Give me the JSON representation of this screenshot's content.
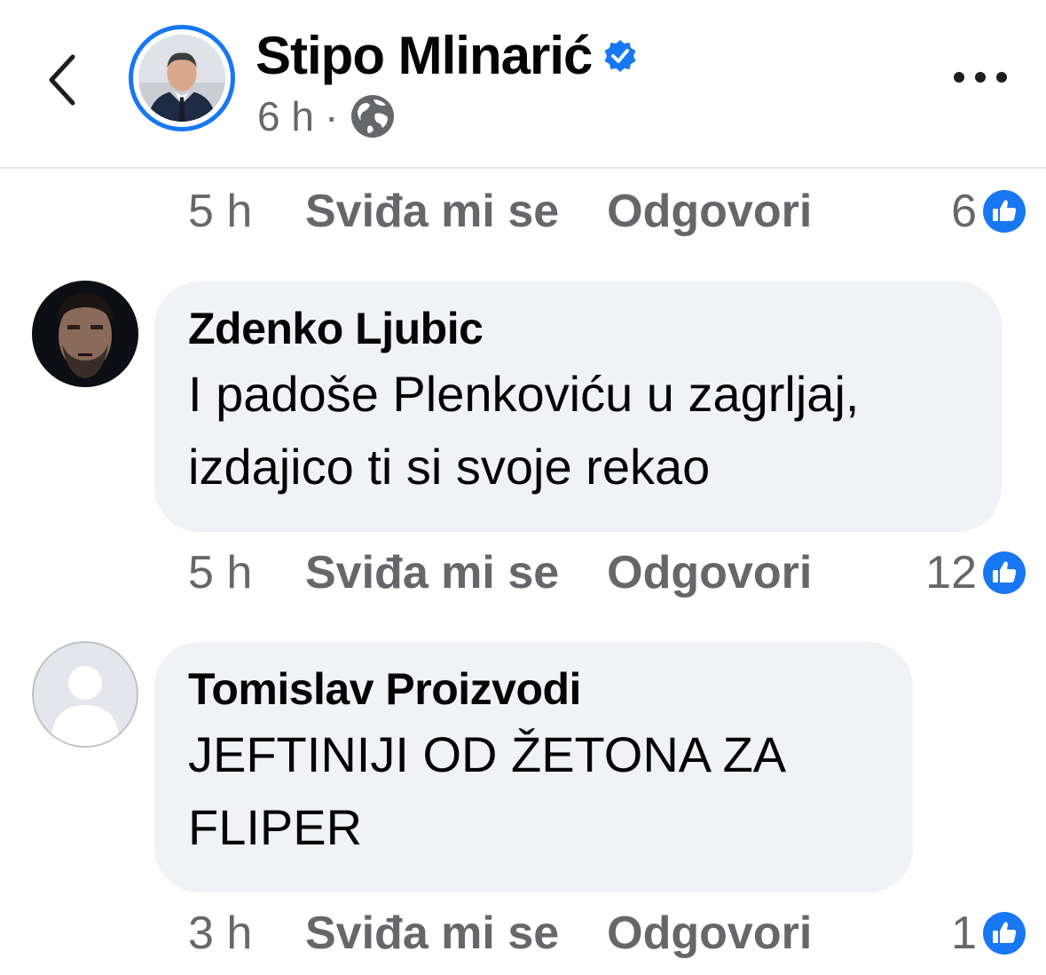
{
  "header": {
    "author": "Stipo Mlinarić",
    "time": "6 h",
    "separator": "·",
    "icons": {
      "back": "chevron-left-icon",
      "verified": "verified-badge-icon",
      "privacy": "globe-icon",
      "more": "more-horizontal-icon"
    }
  },
  "colors": {
    "accent": "#1877f2",
    "bubble": "#f0f2f5",
    "secondary_text": "#65676b",
    "divider": "#e4e6eb"
  },
  "previous_comment_actions": {
    "time": "5 h",
    "like_label": "Sviđa mi se",
    "reply_label": "Odgovori",
    "reaction_count": "6",
    "reaction_icon": "like-icon"
  },
  "comments": [
    {
      "author": "Zdenko Ljubic",
      "text": "I padoše Plenkoviću u zagrljaj, izdajico ti si svoje rekao",
      "time": "5 h",
      "like_label": "Sviđa mi se",
      "reply_label": "Odgovori",
      "reaction_count": "12",
      "reaction_icon": "like-icon"
    },
    {
      "author": "Tomislav Proizvodi",
      "text": "JEFTINIJI OD ŽETONA ZA FLIPER",
      "time": "3 h",
      "like_label": "Sviđa mi se",
      "reply_label": "Odgovori",
      "reaction_count": "1",
      "reaction_icon": "like-icon"
    }
  ]
}
